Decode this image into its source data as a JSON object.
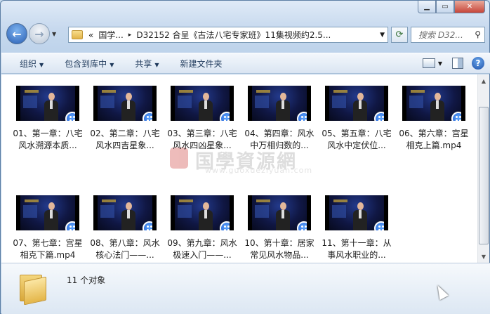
{
  "window": {
    "caption_buttons": [
      "minimize",
      "maximize",
      "close"
    ],
    "close_glyph": "✕"
  },
  "address_bar": {
    "prefix": "«",
    "crumbs": [
      "国学...",
      "D32152 合呈《古法八宅专家班》11集视频约2.5..."
    ],
    "separator": "▸"
  },
  "search": {
    "placeholder": "搜索 D32...",
    "icon": "search-icon"
  },
  "toolbar": {
    "organize": "组织",
    "include_in_library": "包含到库中",
    "share": "共享",
    "new_folder": "新建文件夹"
  },
  "files": [
    {
      "name": "01、第一章：八宅风水溯源本质..."
    },
    {
      "name": "02、第二章：八宅风水四吉星象..."
    },
    {
      "name": "03、第三章：八宅风水四凶星象..."
    },
    {
      "name": "04、第四章：风水中万相归数的..."
    },
    {
      "name": "05、第五章：八宅风水中定伏位..."
    },
    {
      "name": "06、第六章：宫星相克上篇.mp4"
    },
    {
      "name": "07、第七章：宫星相克下篇.mp4"
    },
    {
      "name": "08、第八章：风水核心法门——..."
    },
    {
      "name": "09、第九章：风水极速入门——..."
    },
    {
      "name": "10、第十章：居家常见风水物品..."
    },
    {
      "name": "11、第十一章：从事风水职业的..."
    }
  ],
  "watermark": {
    "text": "国學資源網",
    "url": "www.guoxueziyuan.com"
  },
  "details": {
    "count_text": "11 个对象"
  },
  "colors": {
    "accent": "#1f5dd1",
    "toolbar_text": "#1e395b"
  }
}
